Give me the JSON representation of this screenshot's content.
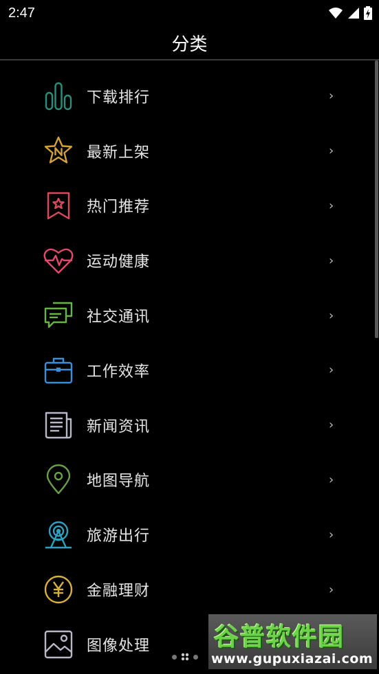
{
  "status": {
    "time": "2:47"
  },
  "header": {
    "title": "分类"
  },
  "colors": {
    "background": "#000000",
    "download": "#2a8f7c",
    "new": "#d4a23a",
    "hot": "#d84b5d",
    "health": "#e24a6a",
    "social": "#6bb24a",
    "work": "#3a8fd8",
    "news": "#b8b8c8",
    "map": "#6aa04a",
    "travel": "#2fa0c0",
    "finance": "#d8b040",
    "image": "#b8b8c8"
  },
  "categories": [
    {
      "label": "下载排行",
      "icon": "bar-chart-icon"
    },
    {
      "label": "最新上架",
      "icon": "new-star-icon"
    },
    {
      "label": "热门推荐",
      "icon": "bookmark-star-icon"
    },
    {
      "label": "运动健康",
      "icon": "heartbeat-icon"
    },
    {
      "label": "社交通讯",
      "icon": "chat-bubbles-icon"
    },
    {
      "label": "工作效率",
      "icon": "briefcase-icon"
    },
    {
      "label": "新闻资讯",
      "icon": "newspaper-icon"
    },
    {
      "label": "地图导航",
      "icon": "map-pin-icon"
    },
    {
      "label": "旅游出行",
      "icon": "ferris-wheel-icon"
    },
    {
      "label": "金融理财",
      "icon": "yen-coin-icon"
    },
    {
      "label": "图像处理",
      "icon": "image-icon"
    }
  ],
  "chevron": "›",
  "watermark": {
    "title": "谷普软件园",
    "url": "www.gupuxiazai.com"
  }
}
